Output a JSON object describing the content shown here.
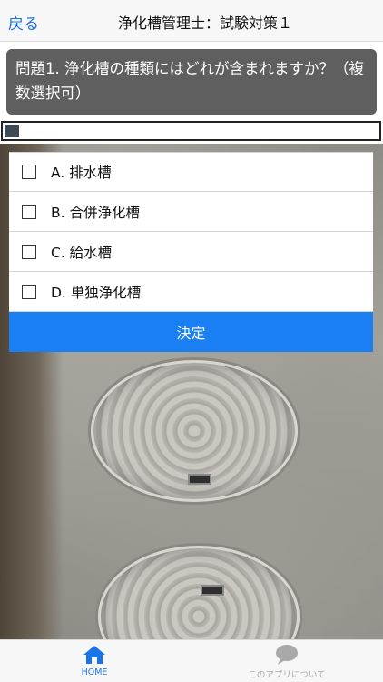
{
  "navbar": {
    "back_label": "戻る",
    "title": "浄化槽管理士：試験対策１"
  },
  "question": {
    "text": "問題1. 浄化槽の種類にはどれが含まれますか？（複数選択可）",
    "progress": 0.04
  },
  "options": [
    {
      "label": "A. 排水槽",
      "checked": false
    },
    {
      "label": "B. 合併浄化槽",
      "checked": false
    },
    {
      "label": "C. 給水槽",
      "checked": false
    },
    {
      "label": "D. 単独浄化槽",
      "checked": false
    }
  ],
  "submit_label": "決定",
  "tabbar": {
    "home_label": "HOME",
    "about_label": "このアプリについて"
  },
  "colors": {
    "accent": "#1a7ff2",
    "question_bg": "#5f5f5f",
    "tab_active": "#1a73e8",
    "tab_inactive": "#aaaaaa"
  }
}
